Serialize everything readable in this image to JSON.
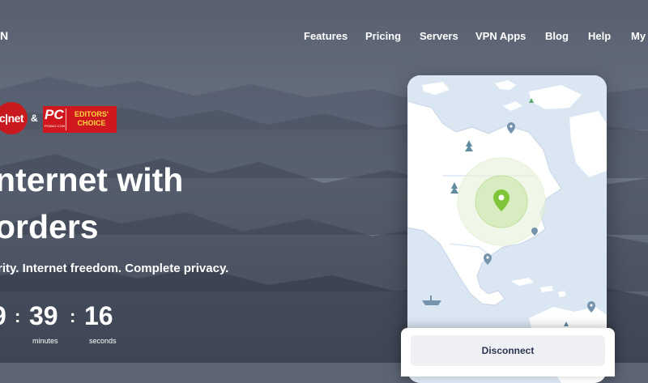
{
  "header": {
    "logo_fragment": "N",
    "nav": [
      "Features",
      "Pricing",
      "Servers",
      "VPN Apps",
      "Blog",
      "Help",
      "My"
    ]
  },
  "awards": {
    "cnet": "c|net",
    "ampersand": "&",
    "pc_logo": "PC",
    "pc_subtext": "PCMAG.COM",
    "pc_award_line1": "EDITORS'",
    "pc_award_line2": "CHOICE"
  },
  "hero": {
    "headline_line1": "nternet with",
    "headline_line2": "orders",
    "subtitle": "rity. Internet freedom. Complete privacy."
  },
  "countdown": {
    "hours": "9",
    "minutes": "39",
    "seconds": "16",
    "separator": ":",
    "minutes_label": "minutes",
    "seconds_label": "seconds"
  },
  "app": {
    "disconnect_label": "Disconnect"
  },
  "colors": {
    "map_water": "#dbe6f3",
    "map_land": "#ffffff",
    "pin_green": "#7ec53a",
    "pin_blue": "#7593ad"
  }
}
